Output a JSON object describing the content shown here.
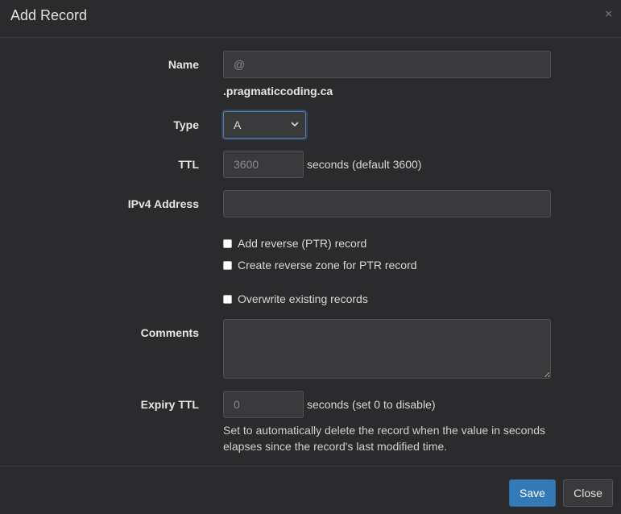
{
  "modal": {
    "title": "Add Record",
    "close_glyph": "×"
  },
  "form": {
    "name": {
      "label": "Name",
      "placeholder": "@",
      "domain_suffix": ".pragmaticcoding.ca"
    },
    "type": {
      "label": "Type",
      "selected": "A"
    },
    "ttl": {
      "label": "TTL",
      "placeholder": "3600",
      "suffix": "seconds (default 3600)"
    },
    "ipv4": {
      "label": "IPv4 Address",
      "value": ""
    },
    "checkboxes": {
      "add_ptr": "Add reverse (PTR) record",
      "create_reverse_zone": "Create reverse zone for PTR record",
      "overwrite": "Overwrite existing records"
    },
    "comments": {
      "label": "Comments",
      "value": ""
    },
    "expiry_ttl": {
      "label": "Expiry TTL",
      "placeholder": "0",
      "suffix": "seconds (set 0 to disable)",
      "help": "Set to automatically delete the record when the value in seconds elapses since the record's last modified time."
    }
  },
  "footer": {
    "save_label": "Save",
    "close_label": "Close"
  },
  "colors": {
    "background": "#2b2b2d",
    "input_bg": "#3a3a3c",
    "primary": "#337ab7",
    "focus_ring": "#5b7fa8"
  },
  "icons": {
    "close": "close-icon",
    "select_arrow": "chevron-down-icon"
  }
}
